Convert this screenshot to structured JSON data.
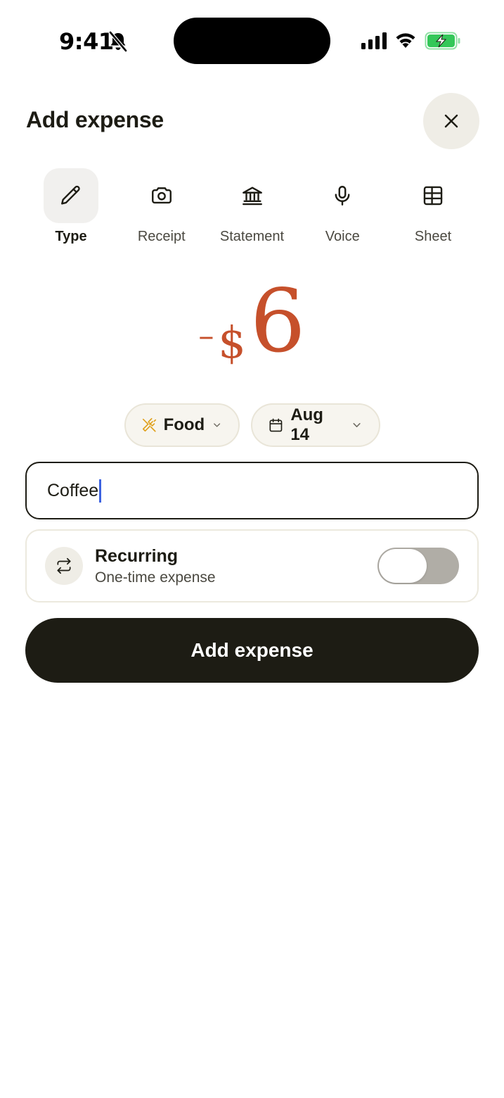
{
  "status_bar": {
    "time": "9:41",
    "icons": [
      "bell-slash-icon",
      "cellular-signal-icon",
      "wifi-icon",
      "battery-charging-icon"
    ]
  },
  "header": {
    "title": "Add expense",
    "close_icon": "close-icon"
  },
  "input_modes": [
    {
      "label": "Type",
      "icon": "pencil-icon",
      "active": true
    },
    {
      "label": "Receipt",
      "icon": "camera-icon",
      "active": false
    },
    {
      "label": "Statement",
      "icon": "bank-icon",
      "active": false
    },
    {
      "label": "Voice",
      "icon": "microphone-icon",
      "active": false
    },
    {
      "label": "Sheet",
      "icon": "table-icon",
      "active": false
    }
  ],
  "amount": {
    "sign": "–",
    "currency": "$",
    "value": "6",
    "color": "#c6502b"
  },
  "chips": {
    "category": {
      "label": "Food",
      "icon": "utensils-crossed-icon",
      "icon_color": "#e0a21f"
    },
    "date": {
      "label": "Aug 14",
      "icon": "calendar-icon"
    }
  },
  "description": {
    "value": "Coffee"
  },
  "recurring": {
    "title": "Recurring",
    "subtitle": "One-time expense",
    "enabled": false
  },
  "primary_action": {
    "label": "Add expense"
  },
  "colors": {
    "text": "#1d1c14",
    "accent": "#c6502b",
    "chip_bg": "#f7f5ef",
    "button_bg": "#1d1c14"
  }
}
